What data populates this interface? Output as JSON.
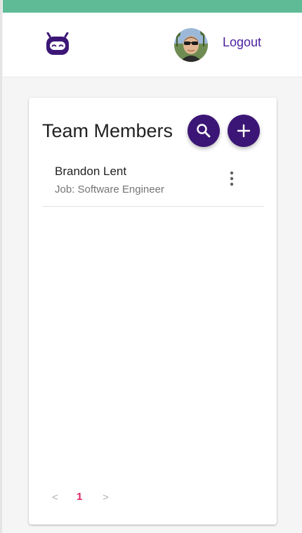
{
  "header": {
    "logo_icon": "robot-logo-icon",
    "avatar_icon": "user-avatar",
    "logout_label": "Logout"
  },
  "colors": {
    "top_strip": "#5fbb96",
    "primary": "#3c1676",
    "link": "#4b1fa0",
    "active_page": "#e0245e"
  },
  "card": {
    "title": "Team Members",
    "search_icon": "search-icon",
    "add_icon": "plus-icon",
    "members": [
      {
        "name": "Brandon Lent",
        "job": "Job: Software Engineer",
        "menu_icon": "more-vert-icon"
      }
    ]
  },
  "pagination": {
    "prev": "<",
    "current": "1",
    "next": ">"
  }
}
